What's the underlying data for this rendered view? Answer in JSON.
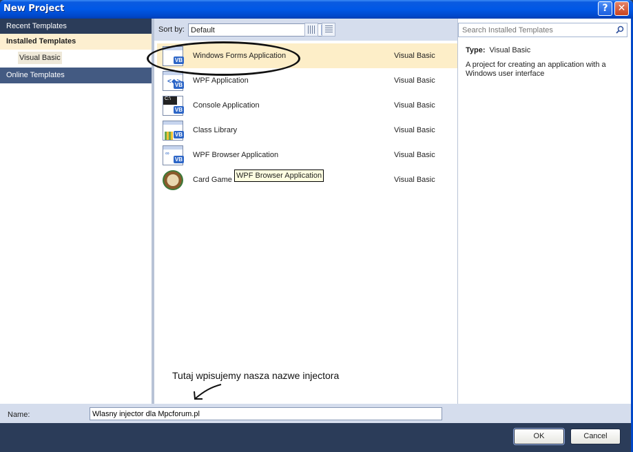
{
  "window": {
    "title": "New Project",
    "help_glyph": "?",
    "close_glyph": "✕"
  },
  "left": {
    "recent": "Recent Templates",
    "installed": "Installed Templates",
    "installed_sub": "Visual Basic",
    "online": "Online Templates"
  },
  "toolbar": {
    "sort_label": "Sort by:",
    "sort_value": "Default"
  },
  "templates": [
    {
      "name": "Windows Forms Application",
      "lang": "Visual Basic",
      "icon": "winforms-vb-icon",
      "selected": true
    },
    {
      "name": "WPF Application",
      "lang": "Visual Basic",
      "icon": "wpf-vb-icon"
    },
    {
      "name": "Console Application",
      "lang": "Visual Basic",
      "icon": "console-vb-icon"
    },
    {
      "name": "Class Library",
      "lang": "Visual Basic",
      "icon": "classlib-vb-icon"
    },
    {
      "name": "WPF Browser Application",
      "lang": "Visual Basic",
      "icon": "wpf-browser-vb-icon"
    },
    {
      "name": "Card Game Starter Kit",
      "lang": "Visual Basic",
      "icon": "card-game-icon"
    }
  ],
  "tooltip": "WPF Browser Application",
  "annotation": {
    "note": "Tutaj wpisujemy nasza nazwe injectora"
  },
  "search": {
    "placeholder": "Search Installed Templates"
  },
  "details": {
    "type_label": "Type:",
    "type_value": "Visual Basic",
    "description": "A project for creating an application with a Windows user interface"
  },
  "name_field": {
    "label": "Name:",
    "value": "Wlasny injector dla Mpcforum.pl"
  },
  "buttons": {
    "ok": "OK",
    "cancel": "Cancel"
  },
  "colors": {
    "frame": "#2b3c59",
    "selected": "#fdeec8",
    "titlebar": "#0058e6"
  }
}
